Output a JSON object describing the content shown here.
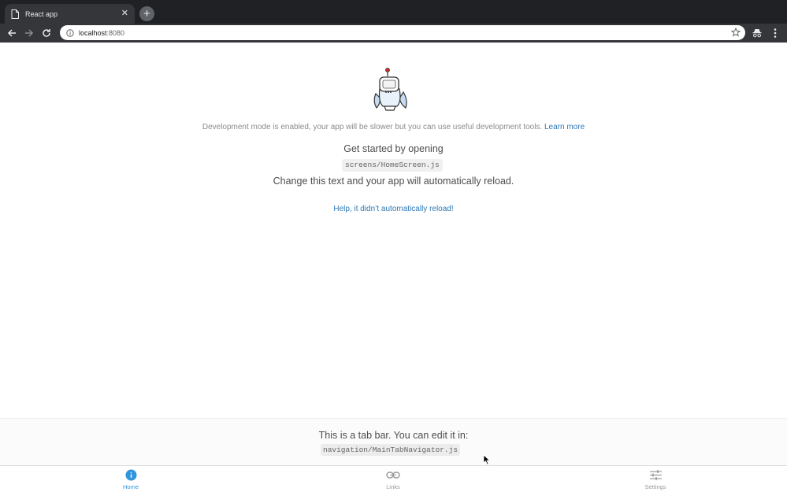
{
  "browser": {
    "tab_title": "React app",
    "tab_close": "✕",
    "new_tab": "+",
    "url_host": "localhost",
    "url_port": ":8080"
  },
  "main": {
    "dev_notice": "Development mode is enabled, your app will be slower but you can use useful development tools.",
    "learn_more": "Learn more",
    "get_started": "Get started by opening",
    "screen_path": "screens/HomeScreen.js",
    "change_text": "Change this text and your app will automatically reload.",
    "help_link": "Help, it didn’t automatically reload!"
  },
  "tab_info": {
    "text": "This is a tab bar. You can edit it in:",
    "path": "navigation/MainTabNavigator.js"
  },
  "bottom_nav": {
    "items": [
      {
        "label": "Home",
        "icon": "info-icon",
        "active": true
      },
      {
        "label": "Links",
        "icon": "link-icon",
        "active": false
      },
      {
        "label": "Settings",
        "icon": "sliders-icon",
        "active": false
      }
    ]
  },
  "colors": {
    "accent": "#2f95dc",
    "link": "#2e78b7",
    "chrome_dark": "#202124",
    "chrome_toolbar": "#35363a"
  }
}
